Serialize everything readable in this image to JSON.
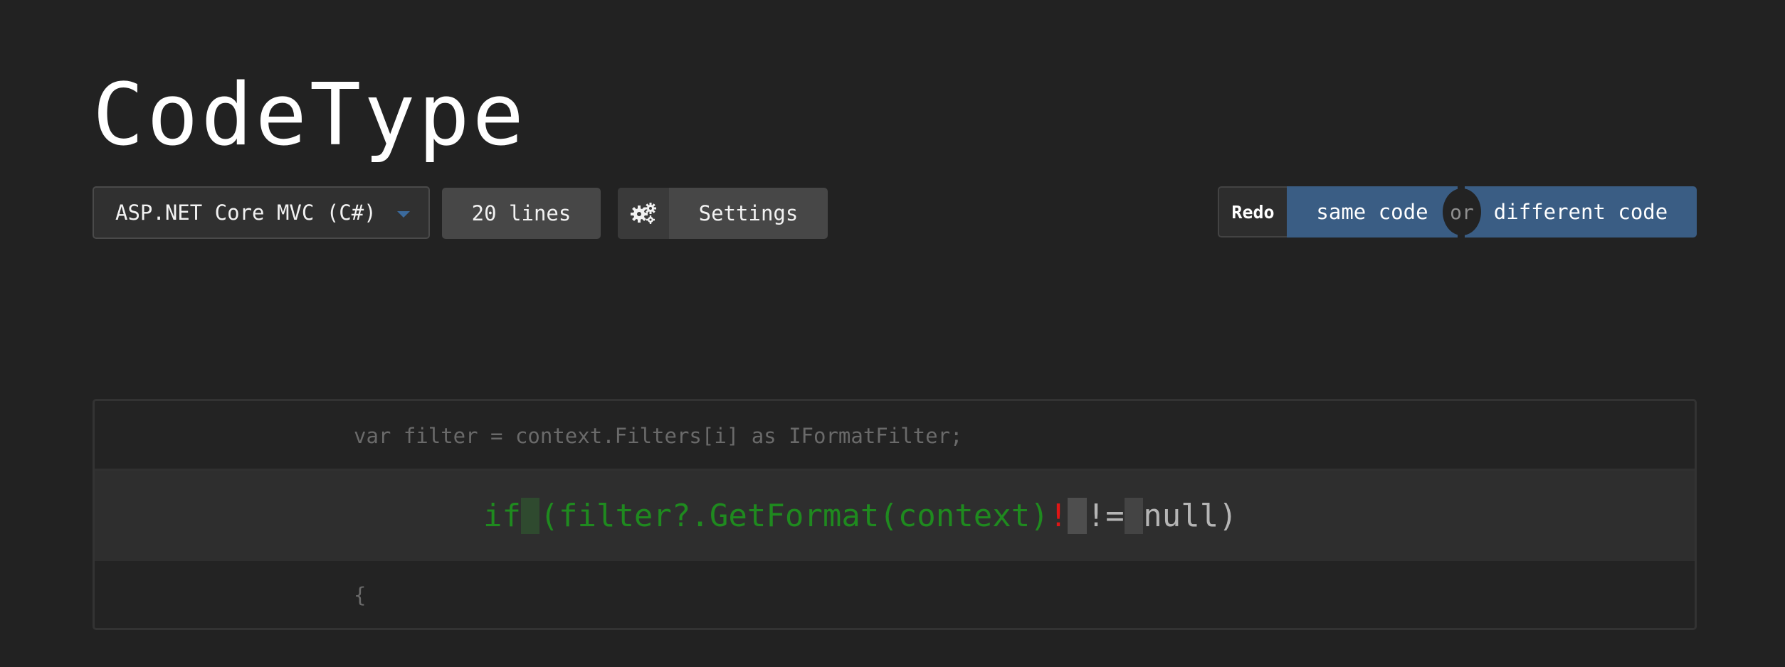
{
  "app": {
    "title": "CodeType"
  },
  "toolbar": {
    "language": "ASP.NET Core MVC (C#)",
    "lines_label": "20 lines",
    "settings_label": "Settings"
  },
  "redo": {
    "label": "Redo",
    "same_label": "same code",
    "or_label": "or",
    "different_label": "different code",
    "button_color": "#3a5d84"
  },
  "code": {
    "prev_line": "var filter = context.Filters[i] as IFormatFilter;",
    "current_line": {
      "typed_1": "if",
      "typed_2": "(filter?.GetFormat(context)",
      "error_char": "!",
      "pending_1": "!=",
      "pending_2": "null)"
    },
    "next_line": "{"
  },
  "colors": {
    "typed": "#1f8a1f",
    "error": "#e01515",
    "pending": "#b5b5b5"
  }
}
